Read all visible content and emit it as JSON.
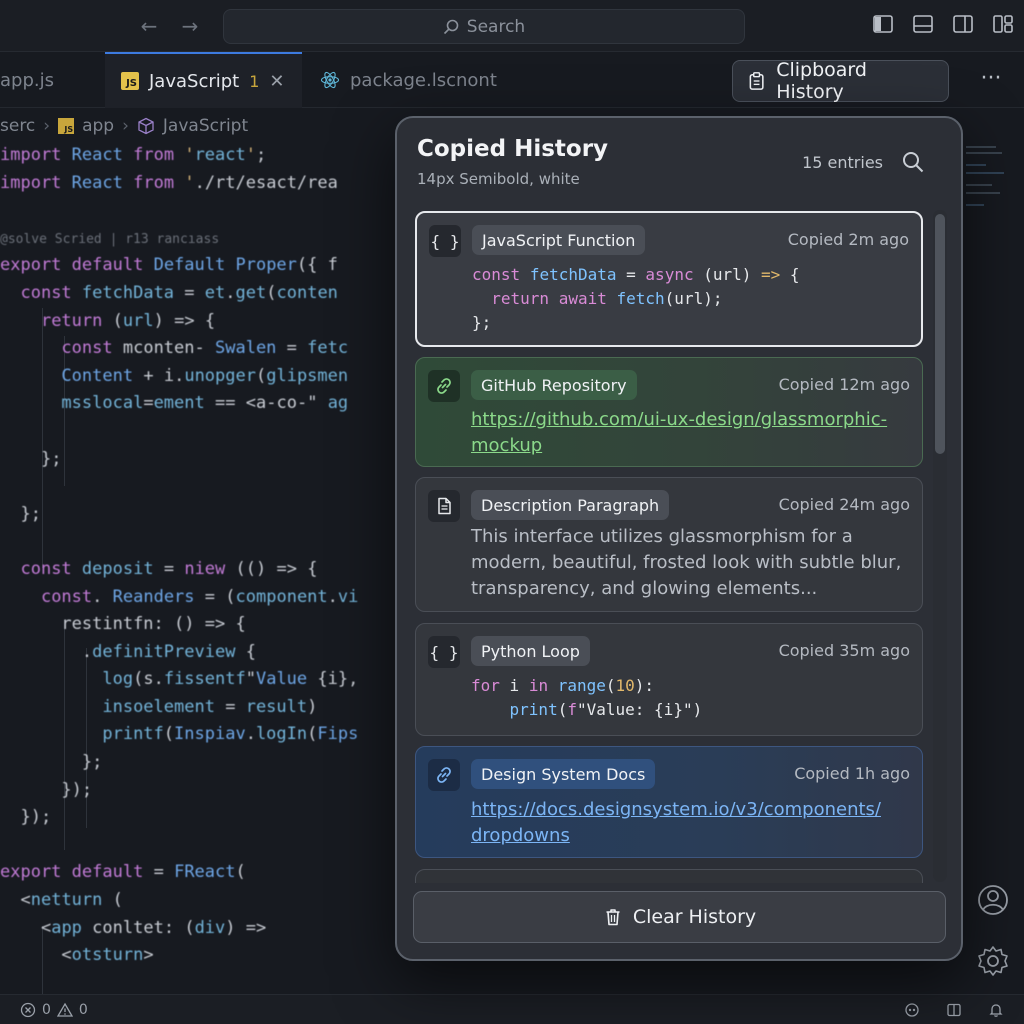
{
  "titlebar": {
    "search_placeholder": "Search",
    "icons": [
      "arrow-left-icon",
      "arrow-right-icon",
      "toggle-primary-sidebar-icon",
      "toggle-panel-icon",
      "toggle-secondary-sidebar-icon",
      "customize-layout-icon"
    ]
  },
  "tabs": [
    {
      "label": "app.js",
      "active": false
    },
    {
      "label": "JavaScript",
      "badge": "1",
      "active": true,
      "icon": "js-file-icon"
    },
    {
      "label": "package.lscnont",
      "active": false,
      "icon": "react-icon"
    }
  ],
  "toolbar": {
    "clipboard_button_label": "Clipboard History",
    "more_label": "···"
  },
  "breadcrumb": [
    "serc",
    "app",
    "JavaScript"
  ],
  "panel": {
    "title": "Copied History",
    "subtitle": "14px Semibold, white",
    "entry_count": "15 entries",
    "clear_label": "Clear History",
    "items": [
      {
        "type": "code",
        "tag": "JavaScript Function",
        "time": "Copied 2m ago",
        "icon": "code-braces-icon",
        "selected": true
      },
      {
        "type": "link",
        "tag": "GitHub Repository",
        "time": "Copied 12m ago",
        "icon": "link-icon",
        "url_lines": [
          "https://github.com/ui-ux-design/glassmorphic-",
          "mockup"
        ]
      },
      {
        "type": "text",
        "tag": "Description Paragraph",
        "time": "Copied 24m ago",
        "icon": "document-icon",
        "text_lines": [
          "This interface utilizes glassmorphism for a",
          "modern, beautiful, frosted look with subtle blur,",
          "transparency, and glowing elements..."
        ]
      },
      {
        "type": "code",
        "tag": "Python Loop",
        "time": "Copied 35m ago",
        "icon": "code-braces-icon"
      },
      {
        "type": "link",
        "tag": "Design System Docs",
        "time": "Copied 1h ago",
        "icon": "link-icon",
        "url_lines": [
          "https://docs.designsystem.io/v3/components/",
          "dropdowns"
        ]
      }
    ]
  },
  "code_snippets": {
    "js_line1": "const fetchData = async (url) => {",
    "js_line2": "  return await fetch(url);",
    "js_line3": "};",
    "py_line1": "for i in range(10):",
    "py_line2": "    print(f\"Value: {i}\")"
  },
  "editor_lines": [
    "import React from 'react';",
    "import React from './rt/esact/rea",
    "",
    "@solve Scried | r13 rancıass",
    "export default Default Proper({ f",
    "  const fetchData = et.get(conten",
    "    return (url) => {",
    "      const mconten- Swalen = fetc",
    "      Content + i.unopger(glipsmen",
    "      msslocal=ement == <a-co-\" ag",
    "",
    "    };",
    "",
    "  };",
    "",
    "  const deposit = niew (() => {",
    "    const. Reanders = (component.vi",
    "      restintfn: () => {",
    "        .definitPreview {",
    "          log(s.fissentf\"Value {i},",
    "          insoelement = result)",
    "          printf(Inspiav.logIn(Fips",
    "        };",
    "      });",
    "  });",
    "",
    "export default = FReact(",
    "  <netturn (",
    "    <app conltet: (div) =>",
    "      <otsturn>"
  ],
  "statusbar": {
    "errors": "0",
    "warnings": "0"
  },
  "colors": {
    "accent_green": "#8bd98a",
    "accent_blue": "#7cb5f5",
    "panel_bg": "#2e3138"
  }
}
